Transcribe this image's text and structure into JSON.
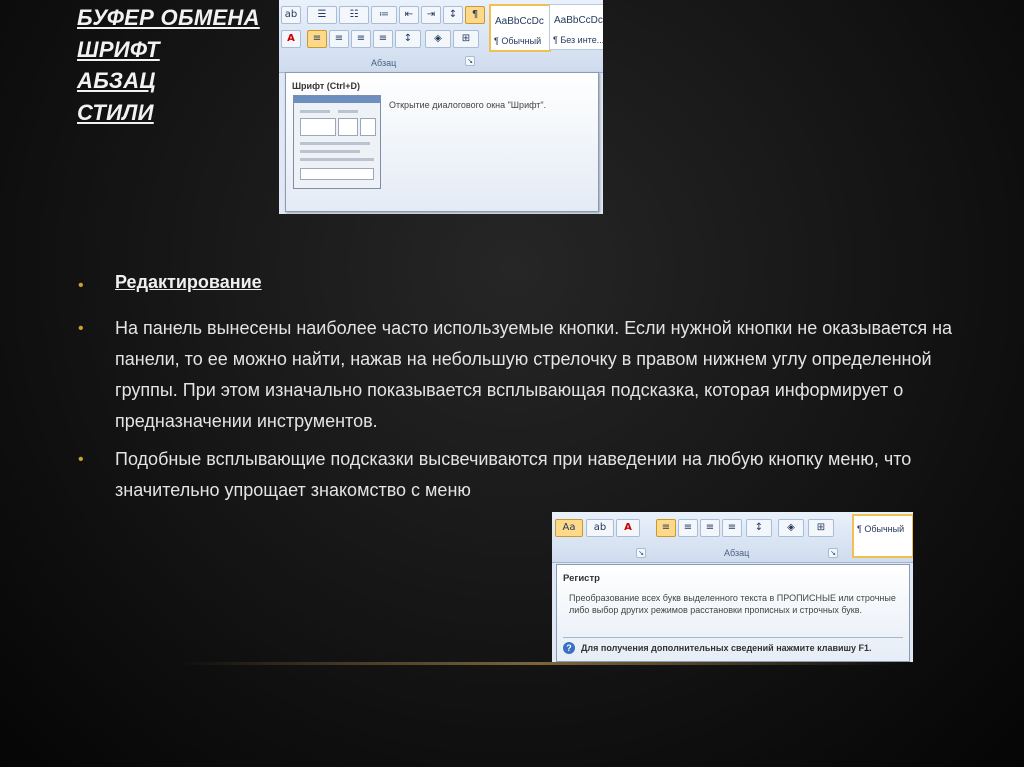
{
  "headings": [
    "БУФЕР ОБМЕНА",
    "ШРИФТ",
    "АБЗАЦ",
    "СТИЛИ"
  ],
  "screenshot1": {
    "styles": [
      {
        "sample": "AaBbCcDc",
        "name": "¶ Обычный"
      },
      {
        "sample": "AaBbCcDc",
        "name": "¶ Без инте..."
      }
    ],
    "group_label": "Абзац",
    "tooltip_title": "Шрифт (Ctrl+D)",
    "tooltip_text": "Открытие диалогового окна \"Шрифт\"."
  },
  "section_heading": "Редактирование",
  "paragraphs": [
    "На панель вынесены наиболее часто используемые кнопки. Если нужной кнопки не оказывается на панели, то ее можно найти, нажав на небольшую стрелочку в правом нижнем углу определенной группы. При этом изначально показывается всплывающая подсказка, которая информирует о предназначении инструментов.",
    "Подобные всплывающие подсказки высвечиваются при наведении на любую кнопку меню, что значительно упрощает знакомство с меню"
  ],
  "screenshot2": {
    "font_button": "Aa",
    "group_label": "Абзац",
    "style_name": "¶ Обычный",
    "tooltip_title": "Регистр",
    "tooltip_text": "Преобразование всех букв выделенного текста в ПРОПИСНЫЕ или строчные либо выбор других режимов расстановки прописных и строчных букв.",
    "help_text": "Для получения дополнительных сведений нажмите клавишу F1."
  },
  "colors": {
    "bullet": "#c9a227",
    "background": "#141414",
    "ribbon": "#dfe8f4"
  }
}
